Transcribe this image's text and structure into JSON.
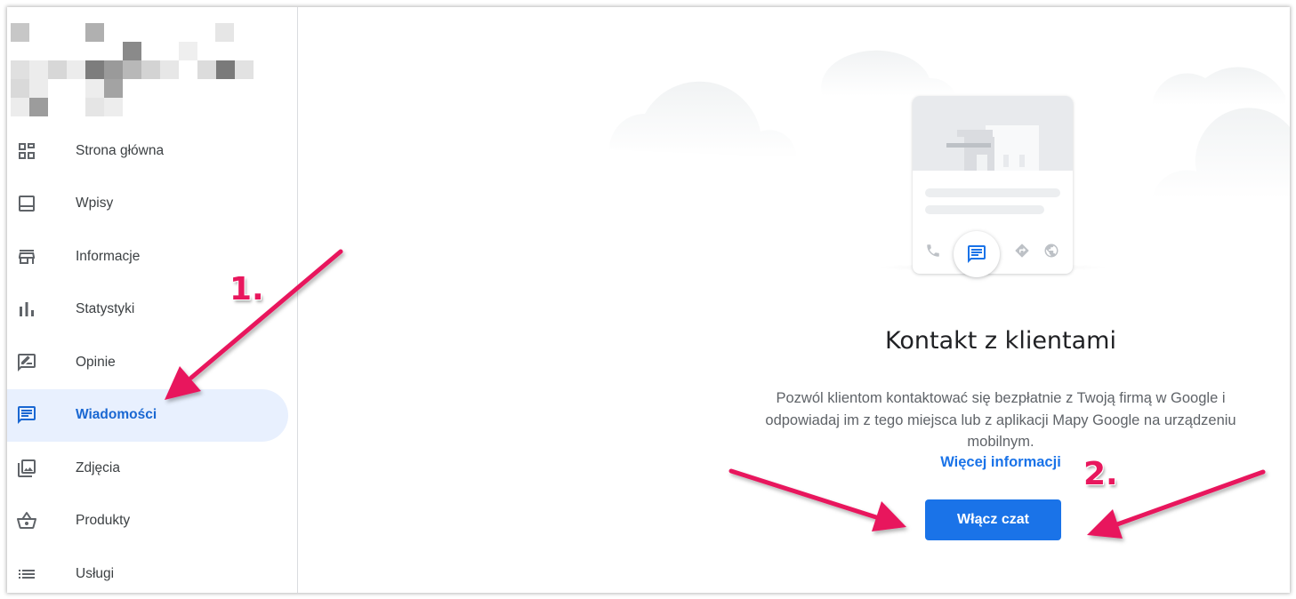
{
  "sidebar": {
    "logo_alt": "",
    "items": [
      {
        "label": "Strona główna",
        "icon": "dashboard-icon",
        "active": false
      },
      {
        "label": "Wpisy",
        "icon": "posts-icon",
        "active": false
      },
      {
        "label": "Informacje",
        "icon": "storefront-icon",
        "active": false
      },
      {
        "label": "Statystyki",
        "icon": "bar-chart-icon",
        "active": false
      },
      {
        "label": "Opinie",
        "icon": "rate-review-icon",
        "active": false
      },
      {
        "label": "Wiadomości",
        "icon": "chat-icon",
        "active": true
      },
      {
        "label": "Zdjęcia",
        "icon": "photo-library-icon",
        "active": false
      },
      {
        "label": "Produkty",
        "icon": "basket-icon",
        "active": false
      },
      {
        "label": "Usługi",
        "icon": "list-icon",
        "active": false
      }
    ]
  },
  "main": {
    "heading": "Kontakt z klientami",
    "description": "Pozwól klientom kontaktować się bezpłatnie z Twoją firmą w Google i odpowiadaj im z tego miejsca lub z aplikacji Mapy Google na urządzeniu mobilnym.",
    "more_link": "Więcej informacji",
    "enable_button": "Włącz czat"
  },
  "annotations": {
    "step1": "1.",
    "step2": "2.",
    "arrow_color": "#e8175d"
  },
  "colors": {
    "accent": "#1a73e8",
    "active_bg": "#e8f0fe",
    "active_text": "#1967d2"
  }
}
